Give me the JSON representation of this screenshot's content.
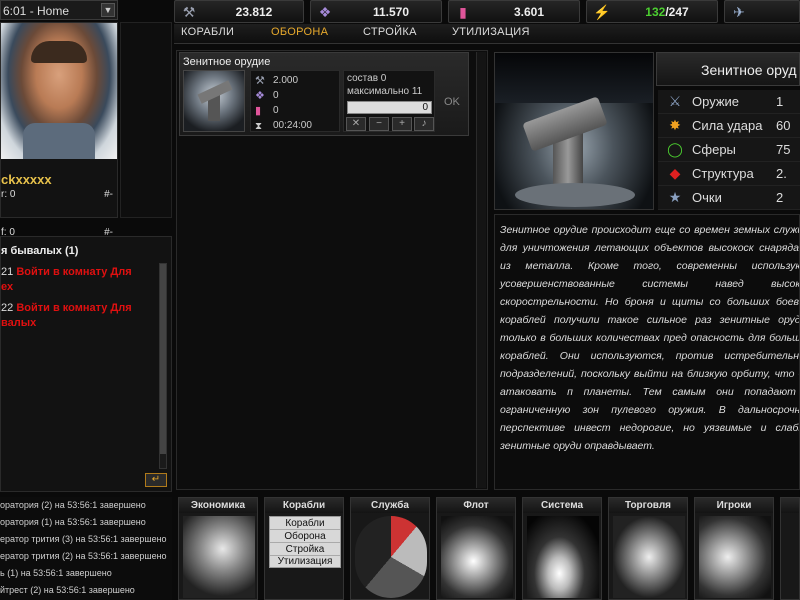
{
  "top_bar": {
    "home_label": "6:01 - Home",
    "resources": [
      {
        "icon": "metal-icon",
        "value": "23.812"
      },
      {
        "icon": "crystal-icon",
        "value": "11.570"
      },
      {
        "icon": "tritium-icon",
        "value": "3.601"
      },
      {
        "icon": "energy-icon",
        "value": "132/247",
        "value_current": "132",
        "value_max": "/247"
      },
      {
        "icon": "storage-icon",
        "value": ""
      }
    ]
  },
  "tabs": [
    {
      "label": "КОРАБЛИ",
      "active": false
    },
    {
      "label": "ОБОРОНА",
      "active": true
    },
    {
      "label": "СТРОЙКА",
      "active": false
    },
    {
      "label": "УТИЛИЗАЦИЯ",
      "active": false
    }
  ],
  "profile": {
    "name": "ckxxxxx",
    "row1_label": "r: 0",
    "row1_right": "#-",
    "row2_label": "f: 0",
    "row2_right": "#-"
  },
  "chat": {
    "title": "я бывалых (1)",
    "messages": [
      {
        "time": "21",
        "link": "Войти в комнату Для",
        "cont": "ех"
      },
      {
        "time": "22",
        "link": "Войти в комнату Для",
        "cont": "валых"
      }
    ]
  },
  "log": [
    "оратория (2) на 53:56:1 завершено",
    "оратория (1) на 53:56:1 завершено",
    "ератор трития (3) на 53:56:1 завершено",
    "ератор трития (2) на 53:56:1 завершено",
    "ь (1) на 53:56:1 завершено",
    "йтрест (2) на 53:56:1 завершено"
  ],
  "unit_card": {
    "title": "Зенитное орудие",
    "cost_metal": "2.000",
    "cost_crystal": "0",
    "cost_tritium": "0",
    "time": "00:24:00",
    "composition": "состав 0",
    "maximum": "максимально 11",
    "quantity": "0",
    "ok_label": "OK"
  },
  "detail": {
    "title": "Зенитное оруд",
    "stats": [
      {
        "icon": "weapon-icon",
        "label": "Оружие",
        "value": "1"
      },
      {
        "icon": "impact-icon",
        "label": "Сила удара",
        "value": "60"
      },
      {
        "icon": "sphere-icon",
        "label": "Сферы",
        "value": "75"
      },
      {
        "icon": "structure-icon",
        "label": "Структура",
        "value": "2."
      },
      {
        "icon": "points-icon",
        "label": "Очки",
        "value": "2"
      }
    ],
    "description": "Зенитное орудие происходит еще со времен земных служит для уничтожения летающих объектов высокоск снарядами из металла. Кроме того, современны используют усовершенствованные системы навед высокой скорострельности. Но броня и щиты со больших боевых кораблей получили такое сильное раз зенитные орудия только в больших количествах пред опасность для больших кораблей. Они используются, против истребительных подразделений, поскольку выйти на близкую орбиту, что бы атаковать п планеты. Тем самым они попадают в ограниченную зон пулевого оружия. В дальносрочной перспективе инвест недорогие, но уязвимые и слабые зенитные оруди оправдывает."
  },
  "menu": [
    {
      "title": "Экономика"
    },
    {
      "title": "Корабли",
      "items": [
        "Корабли",
        "Оборона",
        "Стройка",
        "Утилизация"
      ]
    },
    {
      "title": "Служба"
    },
    {
      "title": "Флот"
    },
    {
      "title": "Система"
    },
    {
      "title": "Торговля"
    },
    {
      "title": "Игроки"
    },
    {
      "title": ""
    }
  ]
}
